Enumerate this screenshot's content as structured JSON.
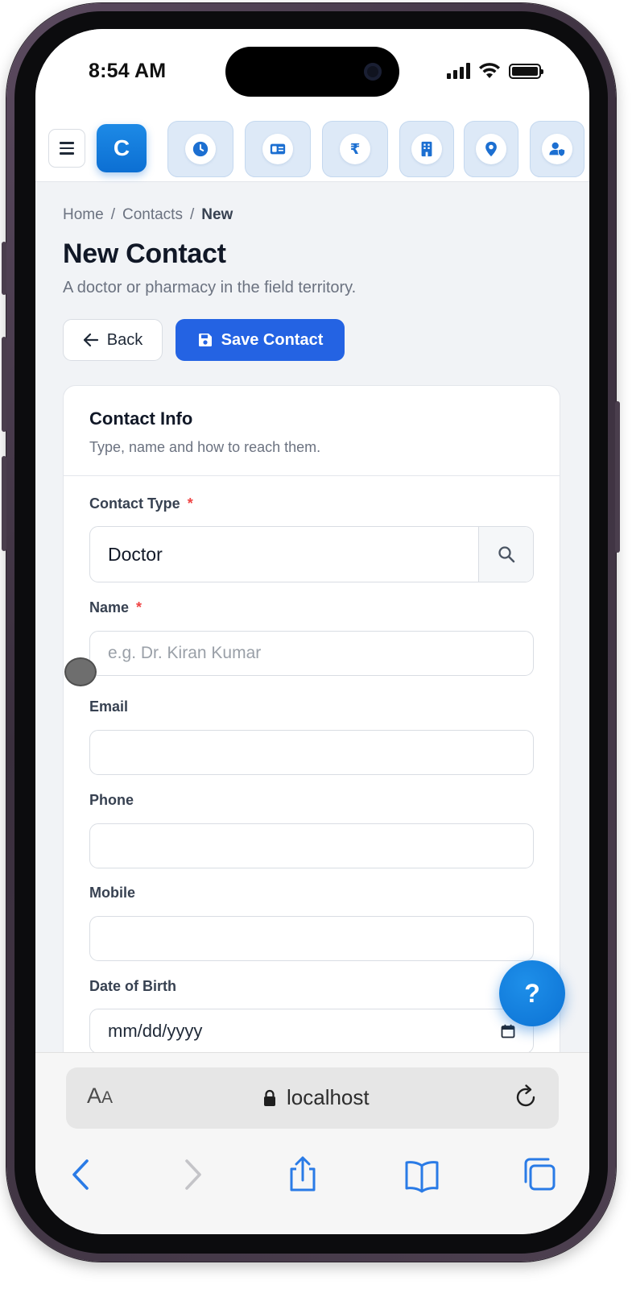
{
  "status_bar": {
    "time": "8:54 AM"
  },
  "toolbar": {
    "logo_letter": "C",
    "rupee_symbol": "₹"
  },
  "breadcrumb": {
    "home": "Home",
    "sep": "/",
    "contacts": "Contacts",
    "current": "New"
  },
  "page": {
    "title": "New Contact",
    "subtitle": "A doctor or pharmacy in the field territory."
  },
  "actions": {
    "back_label": "Back",
    "save_label": "Save Contact"
  },
  "card": {
    "title": "Contact Info",
    "subtitle": "Type, name and how to reach them."
  },
  "form": {
    "required_mark": "*",
    "contact_type": {
      "label": "Contact Type",
      "value": "Doctor"
    },
    "name": {
      "label": "Name",
      "placeholder": "e.g. Dr. Kiran Kumar"
    },
    "email": {
      "label": "Email",
      "value": ""
    },
    "phone": {
      "label": "Phone",
      "value": ""
    },
    "mobile": {
      "label": "Mobile",
      "value": ""
    },
    "date_of_birth": {
      "label": "Date of Birth",
      "value": "mm/dd/yyyy"
    }
  },
  "fab": {
    "label": "?"
  },
  "browser": {
    "aa_large": "A",
    "aa_small": "A",
    "url": "localhost"
  },
  "colors": {
    "primary": "#2463e3",
    "brand": "#0c6fd3",
    "required": "#ef4444"
  }
}
